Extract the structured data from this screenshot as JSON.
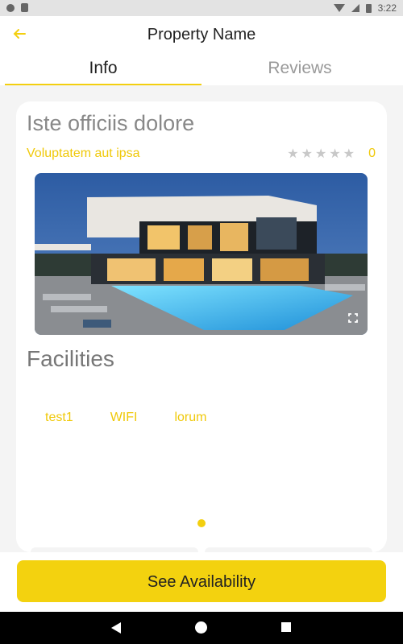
{
  "status_bar": {
    "time": "3:22",
    "icons": [
      "notification-circle-icon",
      "sd-card-icon",
      "wifi-icon",
      "signal-icon",
      "battery-icon"
    ]
  },
  "header": {
    "title": "Property Name",
    "back_icon": "arrow-left-icon",
    "tabs": [
      {
        "label": "Info",
        "active": true
      },
      {
        "label": "Reviews",
        "active": false
      }
    ]
  },
  "property": {
    "name": "Iste officiis dolore",
    "subtitle": "Voluptatem aut ipsa",
    "stars_total": 5,
    "stars_filled": 0,
    "rating": "0",
    "photo_icon": "fullscreen-icon"
  },
  "facilities": {
    "title": "Facilities",
    "items": [
      "test1",
      "WIFI",
      "lorum"
    ]
  },
  "cta": {
    "label": "See Availability"
  },
  "colors": {
    "accent": "#f3d20f",
    "accent_text": "#f0c90a",
    "title_gray": "#888888"
  }
}
